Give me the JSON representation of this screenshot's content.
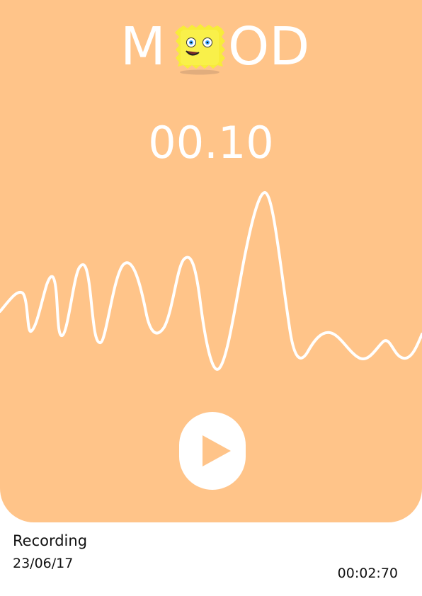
{
  "app": {
    "logo_left": "M",
    "logo_right": "OD",
    "mascot_icon": "fuzzy-yellow-monster-icon"
  },
  "player": {
    "timer": "00.10",
    "play_icon": "play-icon"
  },
  "recording": {
    "title": "Recording",
    "date": "23/06/17",
    "duration": "00:02:70"
  },
  "colors": {
    "background": "#ffc489",
    "accent": "#ffffff",
    "mascot": "#f7ec3a"
  }
}
